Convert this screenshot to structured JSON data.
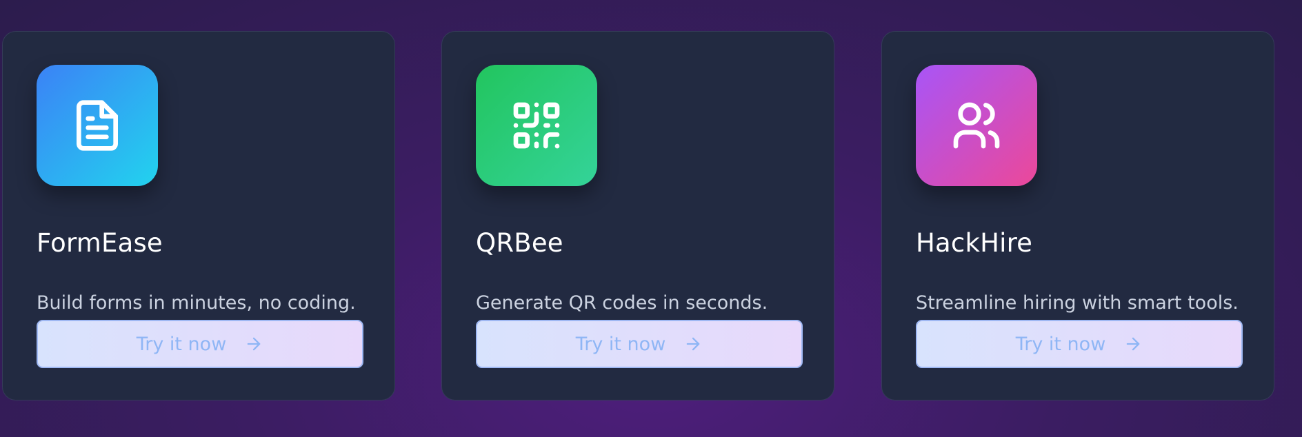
{
  "cards": [
    {
      "name": "FormEase",
      "description": "Build forms in minutes, no coding.",
      "cta_label": "Try it now",
      "icon": "file-text-icon",
      "gradient": [
        "#3b82f6",
        "#22d3ee"
      ]
    },
    {
      "name": "QRBee",
      "description": "Generate QR codes in seconds.",
      "cta_label": "Try it now",
      "icon": "qr-code-icon",
      "gradient": [
        "#22c55e",
        "#34d399"
      ]
    },
    {
      "name": "HackHire",
      "description": "Streamline hiring with smart tools.",
      "cta_label": "Try it now",
      "icon": "users-icon",
      "gradient": [
        "#a855f7",
        "#ec4899"
      ]
    }
  ],
  "colors": {
    "card_background": "#222a41",
    "button_border": "#9fb8f3",
    "button_text": "#8fb6f5"
  }
}
